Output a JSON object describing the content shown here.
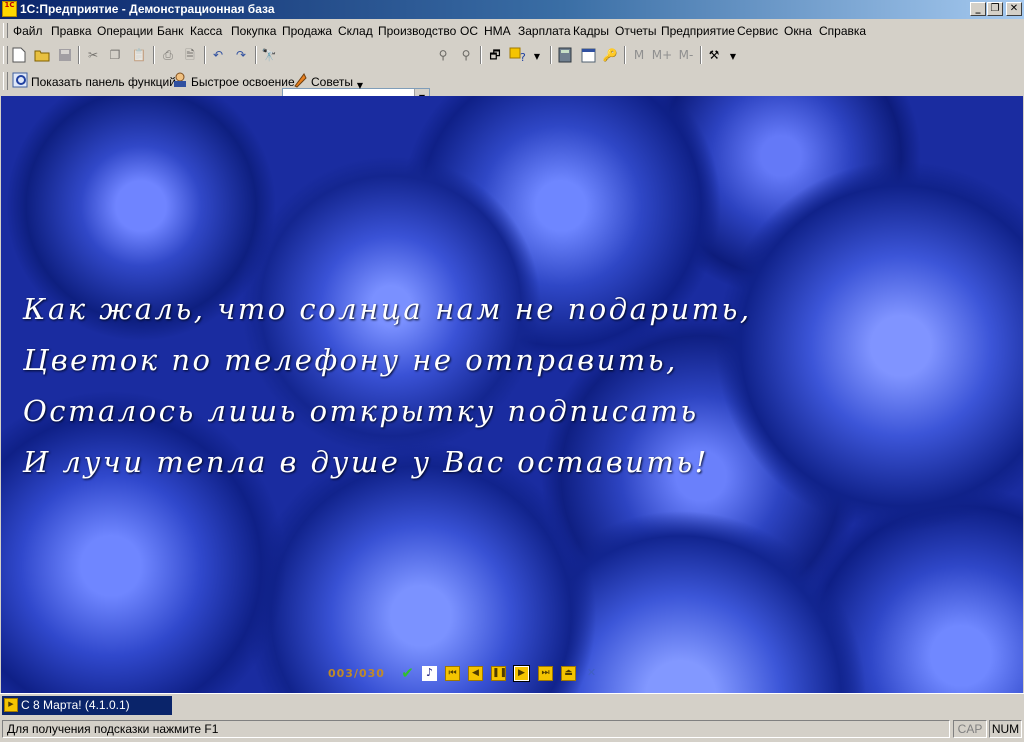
{
  "window": {
    "title": "1С:Предприятие - Демонстрационная база",
    "app_icon_text": "1С",
    "minimize": "_",
    "maximize": "❐",
    "close": "✕"
  },
  "menu": [
    "Файл",
    "Правка",
    "Операции",
    "Банк",
    "Касса",
    "Покупка",
    "Продажа",
    "Склад",
    "Производство",
    "ОС",
    "НМА",
    "Зарплата",
    "Кадры",
    "Отчеты",
    "Предприятие",
    "Сервис",
    "Окна",
    "Справка"
  ],
  "toolbar2": {
    "search_value": "",
    "m_label": "M",
    "m_plus_label": "M+",
    "m_minus_label": "M-"
  },
  "toolbar3": {
    "show_panel": "Показать панель функций",
    "quick_learn": "Быстрое освоение",
    "tips": "Советы"
  },
  "content": {
    "poem": [
      "Как жаль, что солнца нам не подарить,",
      "Цветок по телефону не отправить,",
      "Осталось лишь открытку подписать",
      "И лучи тепла в душе у Вас оставить!"
    ],
    "counter": "003/030",
    "player_icons": [
      "check-icon",
      "note-icon",
      "first-icon",
      "prev-icon",
      "pause-icon",
      "play-icon",
      "last-icon",
      "eject-icon",
      "close-icon"
    ]
  },
  "taskbar": {
    "window_label": "С 8 Марта! (4.1.0.1)"
  },
  "status": {
    "hint": "Для получения подсказки нажмите F1",
    "cap": "CAP",
    "num": "NUM"
  }
}
